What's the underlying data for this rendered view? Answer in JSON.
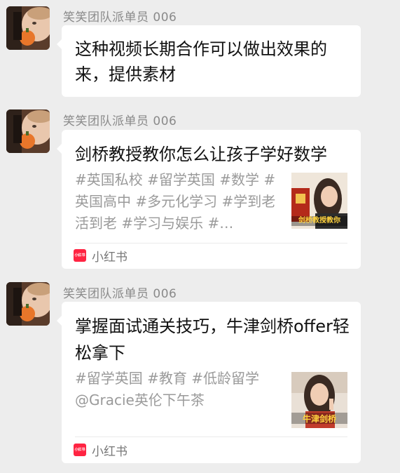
{
  "messages": [
    {
      "sender": "笑笑团队派单员 006",
      "type": "text",
      "text": "这种视频长期合作可以做出效果的来，提供素材"
    },
    {
      "sender": "笑笑团队派单员 006",
      "type": "card",
      "title": "剑桥教授教你怎么让孩子学好数学",
      "description": "#英国私校 #留学英国 #数学 #英国高中 #多元化学习 #学到老活到老 #学习与娱乐 #…",
      "thumbnail_caption": "剑桥教授教你",
      "source": "小红书",
      "source_logo": "小红书"
    },
    {
      "sender": "笑笑团队派单员 006",
      "type": "card",
      "title": "掌握面试通关技巧，牛津剑桥offer轻松拿下",
      "description": "#留学英国 #教育 #低龄留学 @Gracie英伦下午茶",
      "thumbnail_caption": "牛津剑桥",
      "source": "小红书",
      "source_logo": "小红书"
    }
  ],
  "colors": {
    "background": "#ededed",
    "bubble": "#ffffff",
    "sender_text": "#8a8a8a",
    "description_text": "#9a9a9a",
    "xiaohongshu_red": "#ff2442"
  }
}
